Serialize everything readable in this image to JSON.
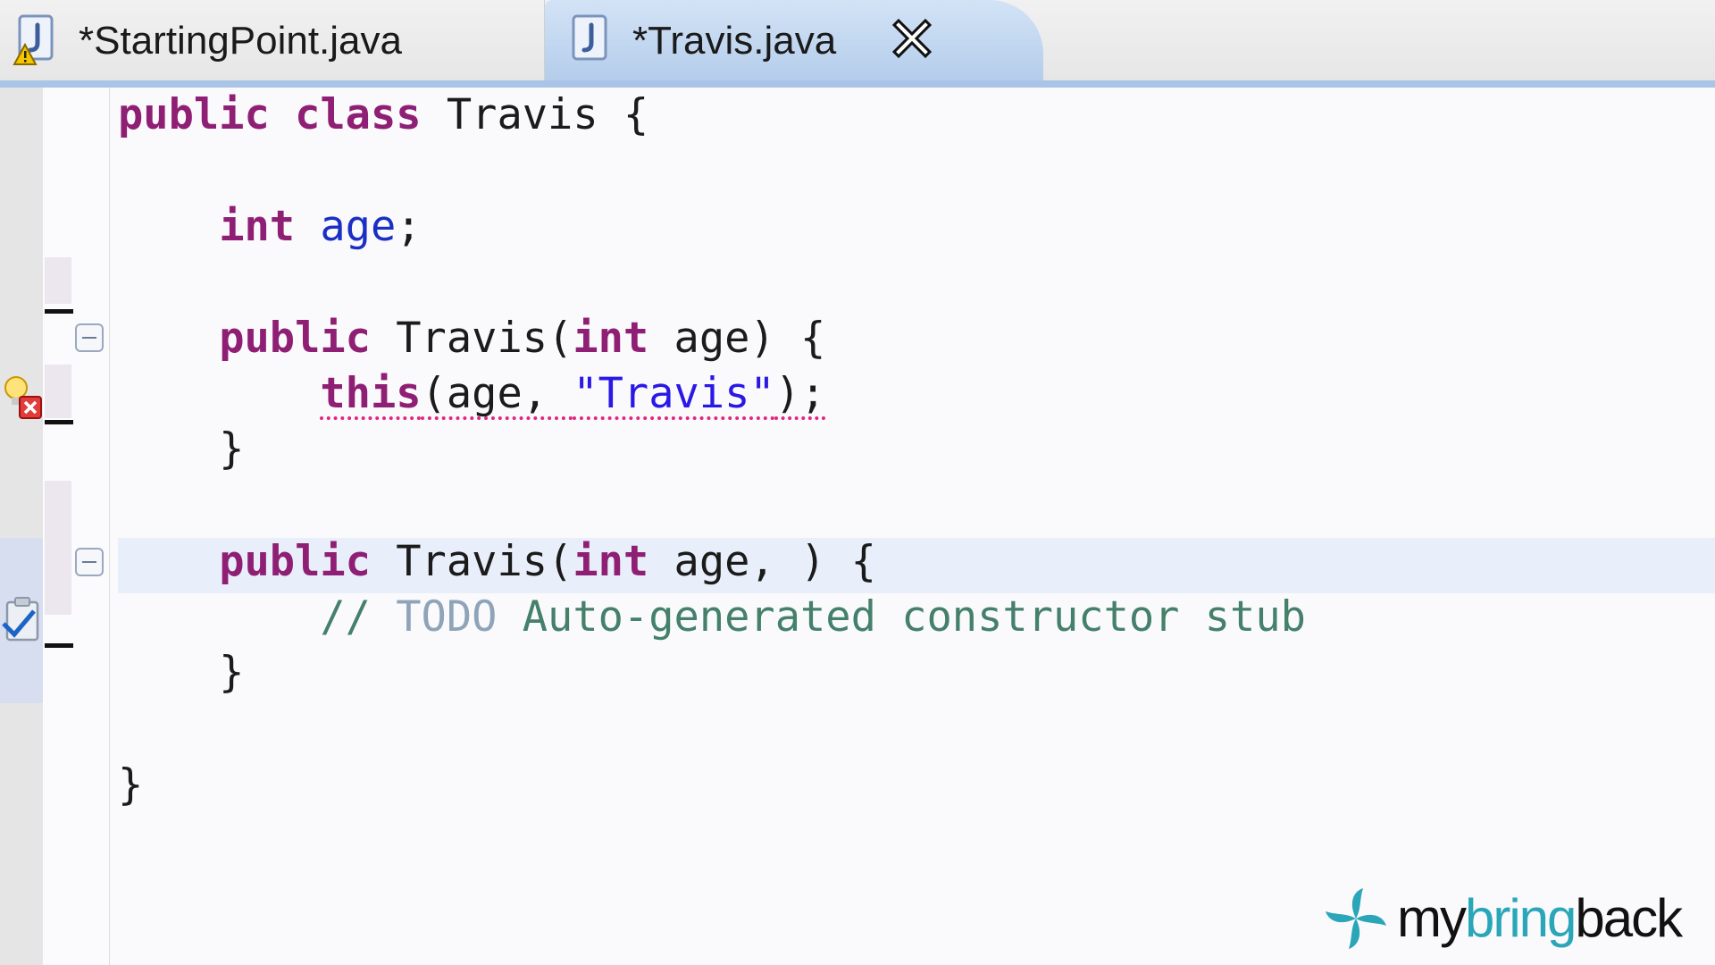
{
  "tabs": [
    {
      "label": "*StartingPoint.java",
      "icon": "java-file-warning-icon",
      "active": false
    },
    {
      "label": "*Travis.java",
      "icon": "java-file-icon",
      "active": true
    }
  ],
  "colors": {
    "keyword": "#8f1f74",
    "field": "#1a2fc4",
    "string": "#2a18e6",
    "comment": "#44806a",
    "error_underline": "#e2267f",
    "accent": "#a9c4e6"
  },
  "code": {
    "line1": {
      "kw1": "public",
      "sp1": " ",
      "kw2": "class",
      "rest": " Travis {"
    },
    "line3": {
      "indent": "    ",
      "kw": "int",
      "sp": " ",
      "field": "age",
      "semi": ";"
    },
    "line5": {
      "indent": "    ",
      "kw1": "public",
      "mid1": " Travis(",
      "kw2": "int",
      "rest": " age) {"
    },
    "line6": {
      "indent": "        ",
      "kw": "this",
      "mid": "(age, ",
      "str": "\"Travis\"",
      "rest": ");"
    },
    "line7": {
      "text": "    }"
    },
    "line9": {
      "indent": "    ",
      "kw1": "public",
      "mid1": " Travis(",
      "kw2": "int",
      "rest": " age, ) {"
    },
    "line10": {
      "indent": "        ",
      "slashes": "// ",
      "todo": "TODO",
      "rest": " Auto-generated constructor stub"
    },
    "line11": {
      "text": "    }"
    },
    "line13": {
      "text": "}"
    }
  },
  "watermark": {
    "part1": "my",
    "part2": "bring",
    "part3": "back",
    "colors": {
      "dark": "#111111",
      "accent": "#2aa6b8"
    }
  }
}
